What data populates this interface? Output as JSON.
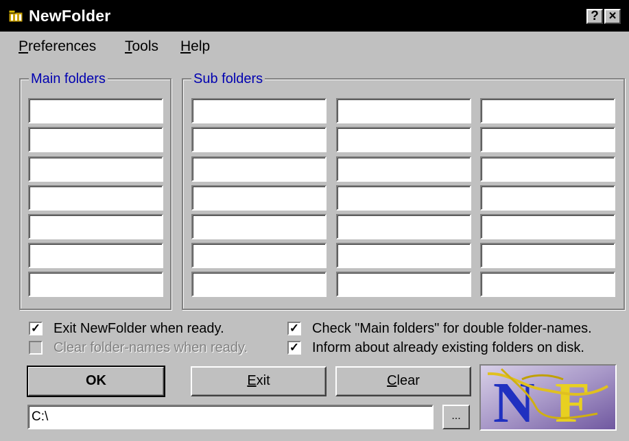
{
  "window": {
    "title": "NewFolder",
    "help_button": "?",
    "close_button": "×"
  },
  "menu": [
    "Preferences",
    "Tools",
    "Help"
  ],
  "main_folders": {
    "label": "Main folders",
    "fields": [
      "",
      "",
      "",
      "",
      "",
      "",
      ""
    ]
  },
  "sub_folders": {
    "label": "Sub folders",
    "columns": [
      [
        "",
        "",
        "",
        "",
        "",
        "",
        ""
      ],
      [
        "",
        "",
        "",
        "",
        "",
        "",
        ""
      ],
      [
        "",
        "",
        "",
        "",
        "",
        "",
        ""
      ]
    ]
  },
  "options": {
    "exit_when_ready": {
      "label": "Exit NewFolder when ready.",
      "checked": true,
      "enabled": true
    },
    "clear_names": {
      "label": "Clear folder-names when ready.",
      "checked": false,
      "enabled": false
    },
    "check_double": {
      "label": "Check \"Main folders\" for double folder-names.",
      "checked": true,
      "enabled": true
    },
    "inform_existing": {
      "label": "Inform about already existing folders on disk.",
      "checked": true,
      "enabled": true
    }
  },
  "buttons": {
    "ok": "OK",
    "exit": "Exit",
    "clear": "Clear",
    "browse": "..."
  },
  "path": {
    "value": "C:\\"
  },
  "logo": {
    "text": "NF"
  },
  "colors": {
    "titlebar": "#000000",
    "group_label": "#0000b0",
    "face": "#c0c0c0"
  }
}
